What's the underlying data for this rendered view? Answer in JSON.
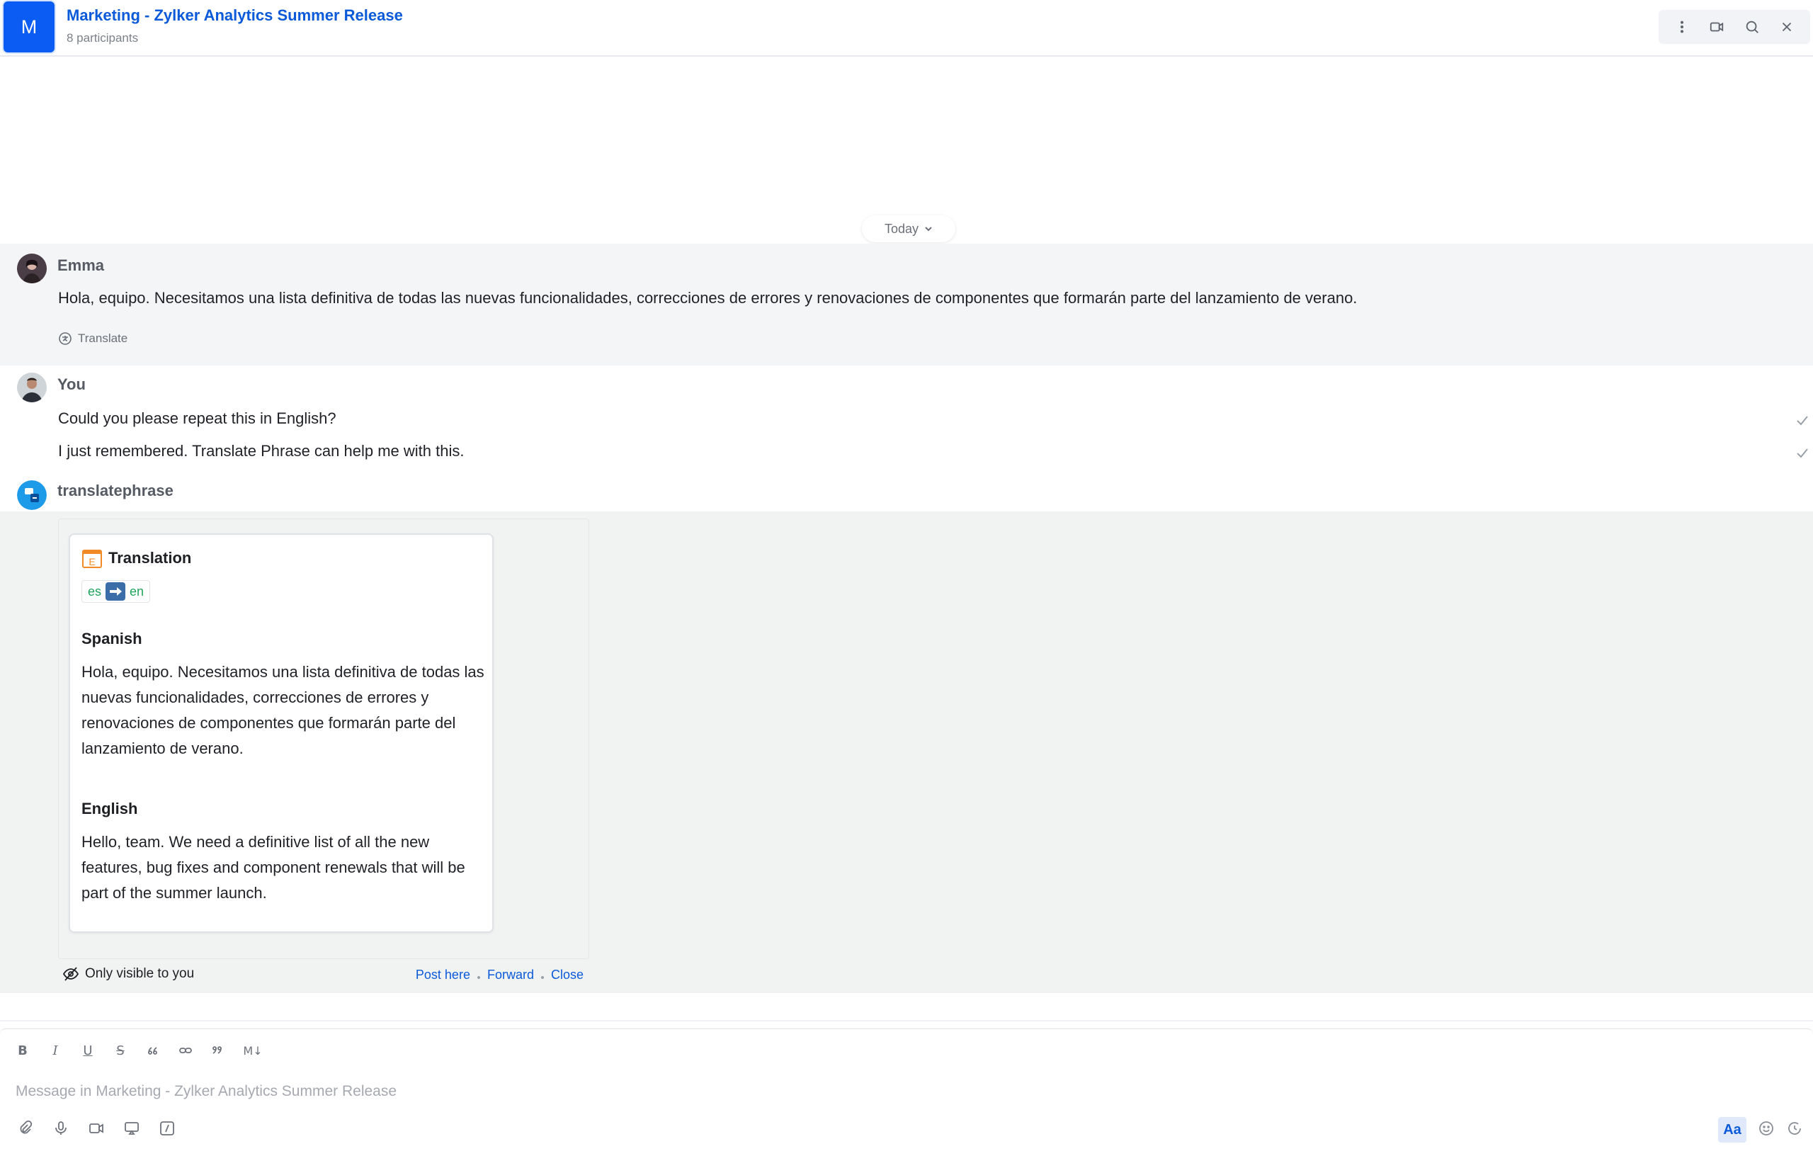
{
  "header": {
    "avatar_letter": "M",
    "title": "Marketing - Zylker Analytics Summer Release",
    "subtitle": "8 participants"
  },
  "date_chip": {
    "label": "Today"
  },
  "messages": {
    "emma": {
      "sender": "Emma",
      "text": "Hola, equipo. Necesitamos una lista definitiva de todas las nuevas funcionalidades, correcciones de errores y renovaciones de componentes que formarán parte del lanzamiento de verano.",
      "translate_label": "Translate"
    },
    "you": {
      "sender": "You",
      "lines": [
        "Could you please repeat this in English?",
        "I just remembered. Translate Phrase can help me with this."
      ]
    },
    "bot": {
      "sender": "translatephrase",
      "card": {
        "title": "Translation",
        "from_lang": "es",
        "to_lang": "en",
        "source_heading": "Spanish",
        "source_text": "Hola, equipo. Necesitamos una lista definitiva de todas las nuevas funcionalidades, correcciones de errores y renovaciones de componentes que formarán parte del lanzamiento de verano.",
        "target_heading": "English",
        "target_text": "Hello, team. We need a definitive list of all the new features, bug fixes and component renewals that will be part of the summer launch."
      },
      "visibility_label": "Only visible to you",
      "actions": {
        "post_here": "Post here",
        "forward": "Forward",
        "close": "Close"
      }
    }
  },
  "composer": {
    "placeholder": "Message in Marketing - Zylker Analytics Summer Release",
    "format_buttons": [
      "B",
      "I",
      "U",
      "S"
    ],
    "markdown_label": "M↓",
    "aa_label": "Aa"
  },
  "colors": {
    "brand": "#0b5cf2",
    "link": "#0b5ad9",
    "lang_green": "#1fa45a"
  }
}
